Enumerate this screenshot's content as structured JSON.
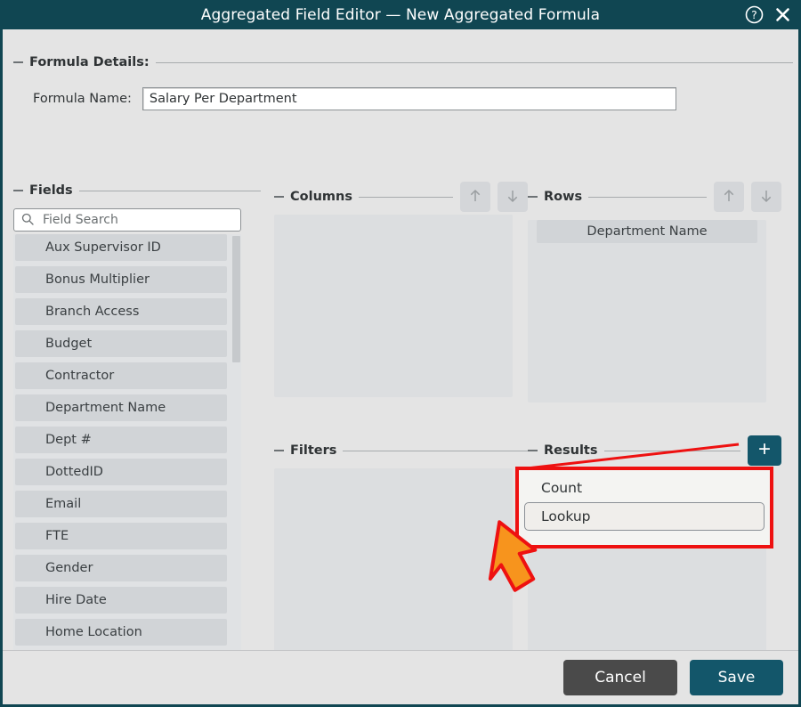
{
  "window": {
    "title": "Aggregated Field Editor — New Aggregated Formula",
    "help_icon": "help-circle-icon",
    "close_icon": "close-icon",
    "titlebar_color": "#104652"
  },
  "formula_details": {
    "group_title": "Formula Details:",
    "name_label": "Formula Name:",
    "name_value": "Salary Per Department",
    "name_placeholder": ""
  },
  "fields": {
    "group_title": "Fields",
    "search": {
      "icon": "search-icon",
      "placeholder": "Field Search",
      "value": ""
    },
    "items": [
      "Aux Supervisor ID",
      "Bonus Multiplier",
      "Branch Access",
      "Budget",
      "Contractor",
      "Department Name",
      "Dept #",
      "DottedID",
      "Email",
      "FTE",
      "Gender",
      "Hire Date",
      "Home Location"
    ]
  },
  "columns": {
    "group_title": "Columns",
    "move_up_icon": "arrow-up-icon",
    "move_down_icon": "arrow-down-icon",
    "items": []
  },
  "rows": {
    "group_title": "Rows",
    "move_up_icon": "arrow-up-icon",
    "move_down_icon": "arrow-down-icon",
    "items": [
      "Department Name"
    ]
  },
  "filters": {
    "group_title": "Filters",
    "items": []
  },
  "results": {
    "group_title": "Results",
    "add_label": "+",
    "add_icon": "plus-icon",
    "add_button_color": "#13566a",
    "items": [],
    "dropdown": {
      "visible": true,
      "options": [
        "Count",
        "Lookup"
      ],
      "highlighted": "Lookup",
      "highlight_border_color": "#ee1111"
    }
  },
  "annotation": {
    "arrow_fill": "#f7941d",
    "arrow_stroke": "#ee1111",
    "pointer_line_color": "#ee1111"
  },
  "footer": {
    "cancel_label": "Cancel",
    "save_label": "Save",
    "cancel_color": "#4a4a4a",
    "save_color": "#13566a"
  }
}
